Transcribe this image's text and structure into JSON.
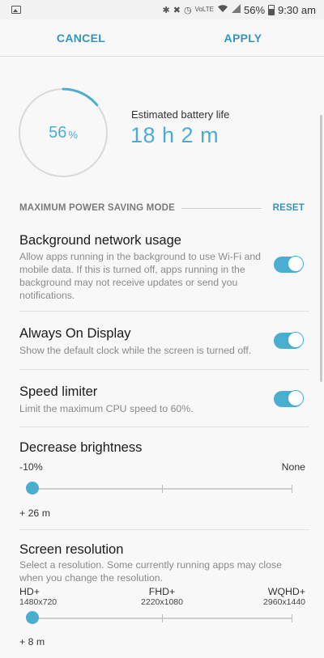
{
  "status_bar": {
    "battery_percent": "56%",
    "time": "9:30 am",
    "volte": "VoLTE",
    "icons": [
      "image-icon",
      "bluetooth-icon",
      "mute-icon",
      "alarm-icon",
      "volte-icon",
      "wifi-icon",
      "signal-icon",
      "battery-icon"
    ]
  },
  "action_bar": {
    "cancel_label": "CANCEL",
    "apply_label": "APPLY"
  },
  "battery": {
    "percent_value": "56",
    "percent_sign": "%",
    "level": 0.56,
    "estimated_label": "Estimated battery life",
    "estimated_value": "18 h 2 m"
  },
  "section": {
    "title": "MAXIMUM POWER SAVING MODE",
    "reset_label": "RESET"
  },
  "settings": {
    "background_network": {
      "title": "Background network usage",
      "description": "Allow apps running in the background to use Wi-Fi and mobile data. If this is turned off, apps running in the background may not receive updates or send you notifications.",
      "enabled": true
    },
    "always_on_display": {
      "title": "Always On Display",
      "description": "Show the default clock while the screen is turned off.",
      "enabled": true
    },
    "speed_limiter": {
      "title": "Speed limiter",
      "description": "Limit the maximum CPU speed to 60%.",
      "enabled": true
    },
    "brightness": {
      "title": "Decrease brightness",
      "min_label": "-10%",
      "max_label": "None",
      "selected_index": 0,
      "gain": "+ 26 m"
    },
    "resolution": {
      "title": "Screen resolution",
      "description": "Select a resolution. Some currently running apps may close when you change the resolution.",
      "options": [
        {
          "name": "HD+",
          "size": "1480x720"
        },
        {
          "name": "FHD+",
          "size": "2220x1080"
        },
        {
          "name": "WQHD+",
          "size": "2960x1440"
        }
      ],
      "selected_index": 0,
      "gain": "+ 8 m"
    }
  },
  "colors": {
    "accent": "#4aaed3",
    "action_text": "#3793bd"
  }
}
